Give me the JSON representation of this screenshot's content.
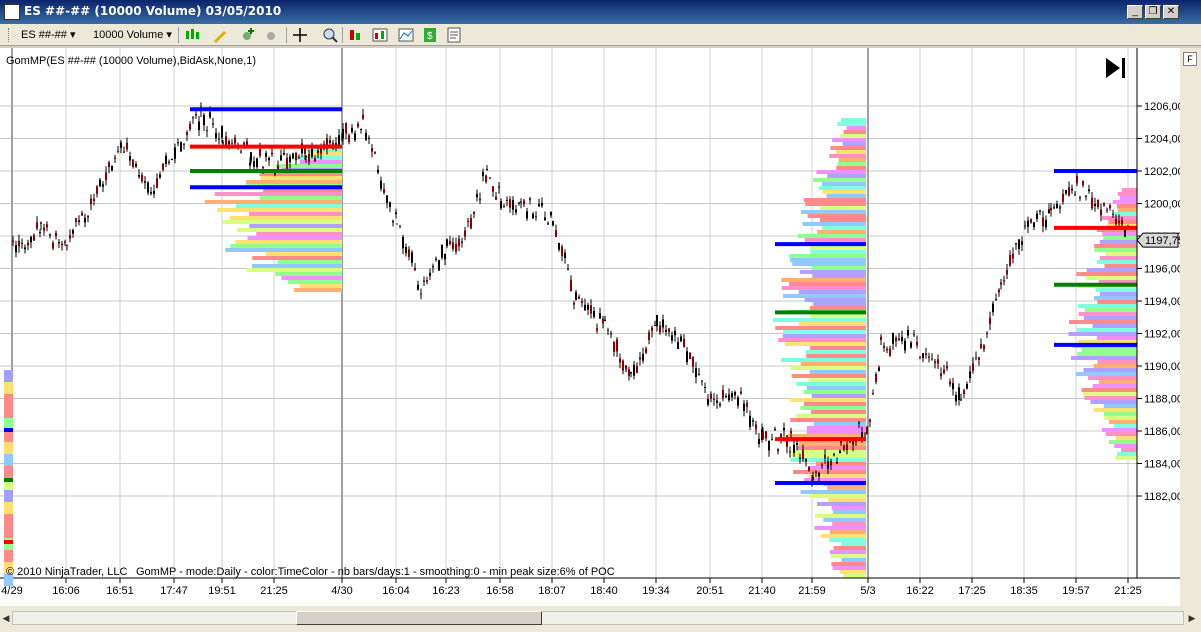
{
  "window": {
    "title": "ES ##-## (10000 Volume)  03/05/2010",
    "minimize": "_",
    "restore": "❐",
    "close": "✕"
  },
  "toolbar": {
    "instrument": "ES ##-##",
    "period": "10000 Volume",
    "icons": [
      "bar-style-icon",
      "drawing-tool-icon",
      "add-indicator-icon",
      "remove-indicator-icon",
      "crosshair-icon",
      "zoom-icon",
      "strategy-icon",
      "chart-trader-icon",
      "chart-style-icon",
      "price-marker-icon",
      "properties-icon"
    ]
  },
  "chart": {
    "indicator_label": "GomMP(ES ##-## (10000 Volume),BidAsk,None,1)",
    "copyright": "© 2010 NinjaTrader, LLC",
    "settings_text": "GomMP - mode:Daily - color:TimeColor - nb bars/days:1 - smoothing:0 - min peak size:6% of POC",
    "last_price": "1197,75",
    "f_button": "F",
    "scroll_right_icon": "skip-to-end-icon"
  },
  "chart_data": {
    "type": "candlestick",
    "y_axis_labels": [
      "1206,00",
      "1204,00",
      "1202,00",
      "1200,00",
      "1198,00",
      "1196,00",
      "1194,00",
      "1192,00",
      "1190,00",
      "1188,00",
      "1186,00",
      "1184,00",
      "1182,00"
    ],
    "ylim": [
      1181,
      1208
    ],
    "x_axis_labels": [
      "4/29",
      "16:06",
      "16:51",
      "17:47",
      "19:51",
      "21:25",
      "4/30",
      "16:04",
      "16:23",
      "16:58",
      "18:07",
      "18:40",
      "19:34",
      "20:51",
      "21:40",
      "21:59",
      "5/3",
      "16:22",
      "17:25",
      "18:35",
      "19:57",
      "21:25"
    ],
    "last_price": 1197.75,
    "levels": [
      {
        "session": "4/29",
        "value_area_high": 1205.8,
        "poc": 1203.5,
        "vwap": 1202.0,
        "value_area_low": 1201.0
      },
      {
        "session": "4/30",
        "value_area_high": 1197.5,
        "poc": 1185.5,
        "vwap": 1193.3,
        "value_area_low": 1182.8
      },
      {
        "session": "5/3",
        "value_area_high": 1202.0,
        "poc": 1198.5,
        "vwap": 1195.0,
        "value_area_low": 1191.3
      }
    ],
    "colors": {
      "value_area": "#0000ff",
      "poc": "#ff0000",
      "vwap": "#008000",
      "candle_up": "#8b0000",
      "candle_down": "#000000"
    }
  }
}
